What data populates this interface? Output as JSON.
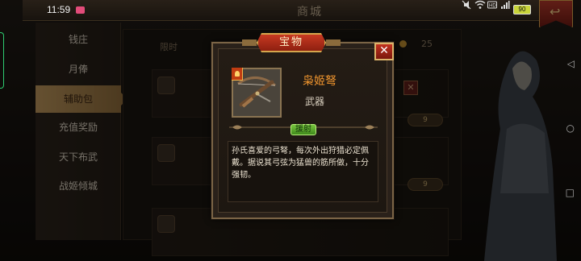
{
  "status_bar": {
    "time": "11:59",
    "battery": "90"
  },
  "shop": {
    "title": "商城",
    "filter_label": "限时",
    "count": "25",
    "rows": [
      {
        "price": "9"
      },
      {
        "price": "9"
      },
      {
        "price": "9"
      }
    ]
  },
  "sidebar": {
    "items": [
      {
        "label": "钱庄"
      },
      {
        "label": "月俸"
      },
      {
        "label": "辅助包",
        "active": true
      },
      {
        "label": "充值奖励"
      },
      {
        "label": "天下布武"
      },
      {
        "label": "战姬倾城"
      }
    ]
  },
  "dialog": {
    "title": "宝物",
    "item_name": "枭姬弩",
    "item_type": "武器",
    "tag": "援射",
    "description": "孙氏喜爱的弓弩，每次外出狩猎必定佩戴。据说其弓弦为猛兽的筋所做，十分强韧。",
    "close_label": "✕"
  },
  "colors": {
    "item_name": "#f0952e",
    "accent_red": "#c73a22",
    "frame_gold": "#d6a64d",
    "tag_green": "#78c53e"
  },
  "icons": [
    "close-icon",
    "back-arrow-icon",
    "crossbow-icon",
    "rank-icon",
    "coin-icon",
    "wifi-icon",
    "mute-icon"
  ]
}
